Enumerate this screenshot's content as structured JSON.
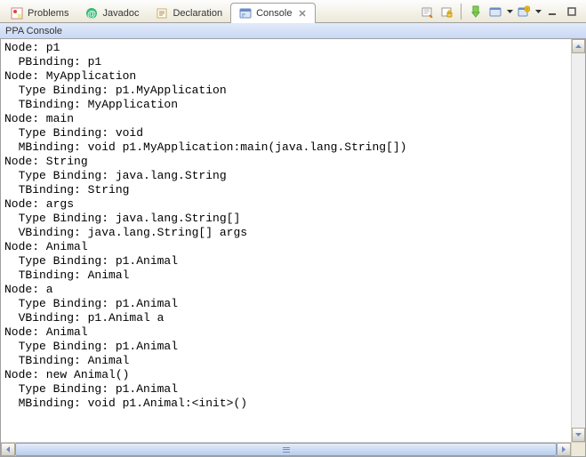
{
  "tabs": {
    "problems": "Problems",
    "javadoc": "Javadoc",
    "declaration": "Declaration",
    "console": "Console"
  },
  "subheader": {
    "title": "PPA Console"
  },
  "console_text": "Node: p1\n  PBinding: p1\nNode: MyApplication\n  Type Binding: p1.MyApplication\n  TBinding: MyApplication\nNode: main\n  Type Binding: void\n  MBinding: void p1.MyApplication:main(java.lang.String[])\nNode: String\n  Type Binding: java.lang.String\n  TBinding: String\nNode: args\n  Type Binding: java.lang.String[]\n  VBinding: java.lang.String[] args\nNode: Animal\n  Type Binding: p1.Animal\n  TBinding: Animal\nNode: a\n  Type Binding: p1.Animal\n  VBinding: p1.Animal a\nNode: Animal\n  Type Binding: p1.Animal\n  TBinding: Animal\nNode: new Animal()\n  Type Binding: p1.Animal\n  MBinding: void p1.Animal:<init>()"
}
